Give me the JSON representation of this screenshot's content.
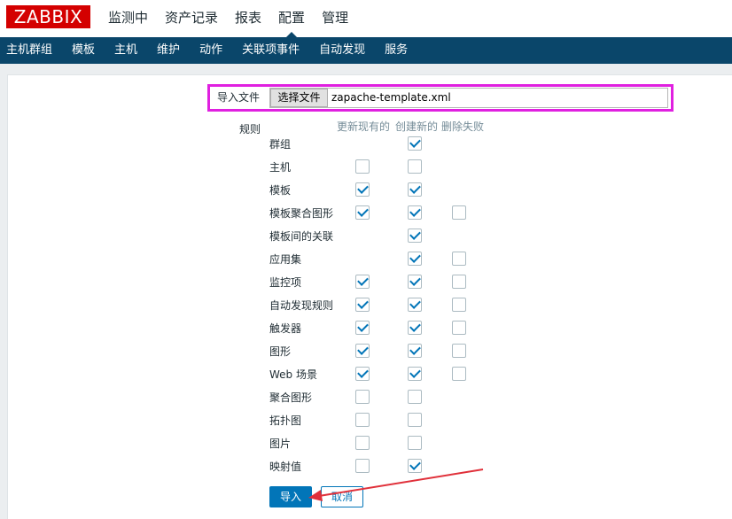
{
  "header": {
    "logo": "ZABBIX",
    "nav": [
      "监测中",
      "资产记录",
      "报表",
      "配置",
      "管理"
    ],
    "active": "配置"
  },
  "subnav": [
    "主机群组",
    "模板",
    "主机",
    "维护",
    "动作",
    "关联项事件",
    "自动发现",
    "服务"
  ],
  "form": {
    "file_label": "导入文件",
    "file_button": "选择文件",
    "file_name": "zapache-template.xml",
    "rules_label": "规则",
    "columns": [
      "更新现有的",
      "创建新的",
      "删除失败"
    ],
    "rows": [
      {
        "label": "群组",
        "update": null,
        "create": true,
        "delete": null
      },
      {
        "label": "主机",
        "update": false,
        "create": false,
        "delete": null
      },
      {
        "label": "模板",
        "update": true,
        "create": true,
        "delete": null
      },
      {
        "label": "模板聚合图形",
        "update": true,
        "create": true,
        "delete": false
      },
      {
        "label": "模板间的关联",
        "update": null,
        "create": true,
        "delete": null
      },
      {
        "label": "应用集",
        "update": null,
        "create": true,
        "delete": false
      },
      {
        "label": "监控项",
        "update": true,
        "create": true,
        "delete": false
      },
      {
        "label": "自动发现规则",
        "update": true,
        "create": true,
        "delete": false
      },
      {
        "label": "触发器",
        "update": true,
        "create": true,
        "delete": false
      },
      {
        "label": "图形",
        "update": true,
        "create": true,
        "delete": false
      },
      {
        "label": "Web 场景",
        "update": true,
        "create": true,
        "delete": false
      },
      {
        "label": "聚合图形",
        "update": false,
        "create": false,
        "delete": null
      },
      {
        "label": "拓扑图",
        "update": false,
        "create": false,
        "delete": null
      },
      {
        "label": "图片",
        "update": false,
        "create": false,
        "delete": null
      },
      {
        "label": "映射值",
        "update": false,
        "create": true,
        "delete": null
      }
    ],
    "import_button": "导入",
    "cancel_button": "取消"
  },
  "colors": {
    "logo_red": "#d40000",
    "subnav_bg": "#0a466a",
    "primary": "#0275b8",
    "highlight": "#e020e0",
    "arrow": "#e0303a"
  }
}
